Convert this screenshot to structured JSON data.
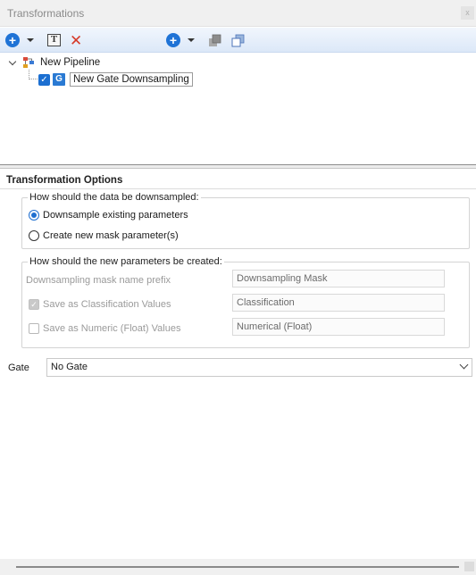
{
  "window": {
    "title": "Transformations",
    "close_glyph": "x"
  },
  "toolbar": {
    "add_icon": "plus-circle-icon",
    "text_icon": "text-box-icon",
    "delete_icon": "red-x-icon",
    "add_transform_icon": "plus-circle-icon",
    "move_up_icon": "layers-up-icon",
    "move_down_icon": "layers-down-icon",
    "text_icon_glyph": "T",
    "delete_glyph": "✕",
    "plus_glyph": "+",
    "colors": {
      "accent": "#1f73d6",
      "danger": "#d63b2a"
    }
  },
  "tree": {
    "root_label": "New Pipeline",
    "child_label": "New Gate Downsampling",
    "child_checked": true,
    "child_icon_glyph": "G",
    "check_glyph": "✓"
  },
  "options": {
    "header": "Transformation Options",
    "downsample_group": {
      "legend": "How should the data be downsampled:",
      "options": [
        {
          "label": "Downsample existing parameters",
          "checked": true
        },
        {
          "label": "Create new mask parameter(s)",
          "checked": false
        }
      ]
    },
    "params_group": {
      "legend": "How should the new parameters be created:",
      "mask_prefix_label": "Downsampling mask name prefix",
      "mask_prefix_value": "Downsampling Mask",
      "classification_label": "Save as Classification Values",
      "classification_checked": true,
      "classification_value": "Classification",
      "numeric_label": "Save as Numeric (Float) Values",
      "numeric_checked": false,
      "numeric_value": "Numerical (Float)"
    },
    "gate_label": "Gate",
    "gate_value": "No Gate"
  }
}
